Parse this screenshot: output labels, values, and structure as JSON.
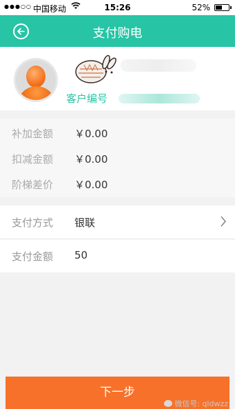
{
  "status_bar": {
    "signal": "●●●○○",
    "carrier": "中国移动",
    "time": "15:26",
    "battery": "52%",
    "battery_level": 0.52
  },
  "navbar": {
    "title": "支付购电",
    "back_icon": "back-circle-icon"
  },
  "profile": {
    "customer_label": "客户编号"
  },
  "amounts": [
    {
      "label": "补加金额",
      "value": "￥0.00"
    },
    {
      "label": "扣减金额",
      "value": "￥0.00"
    },
    {
      "label": "阶梯差价",
      "value": "￥0.00"
    }
  ],
  "payment_method": {
    "label": "支付方式",
    "value": "银联"
  },
  "payment_amount": {
    "label": "支付金额",
    "value": "50"
  },
  "next_button": "下一步",
  "watermark": "微信号: qldwzz",
  "colors": {
    "accent": "#27c4a5",
    "button": "#f7712a"
  }
}
